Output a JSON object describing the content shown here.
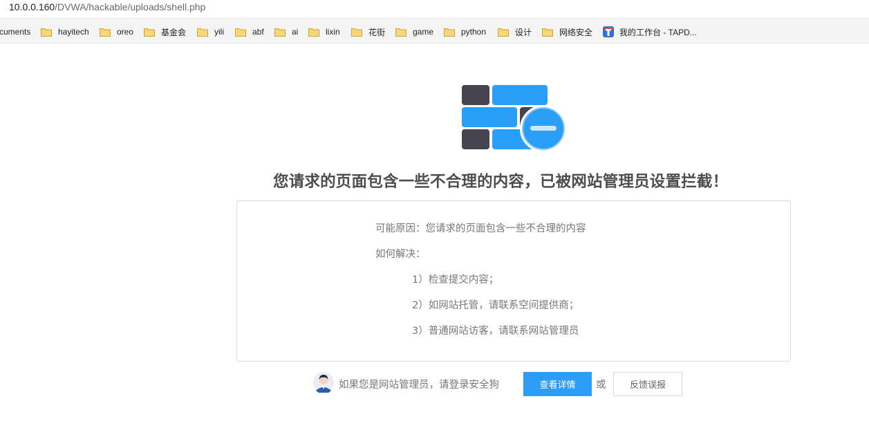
{
  "browser": {
    "url_host": "10.0.0.160",
    "url_path": "/DVWA/hackable/uploads/shell.php",
    "bookmarks": [
      {
        "label": "cuments",
        "icon": "folder-icon"
      },
      {
        "label": "hayitech",
        "icon": "folder-icon"
      },
      {
        "label": "oreo",
        "icon": "folder-icon"
      },
      {
        "label": "基金会",
        "icon": "folder-icon"
      },
      {
        "label": "yili",
        "icon": "folder-icon"
      },
      {
        "label": "abf",
        "icon": "folder-icon"
      },
      {
        "label": "ai",
        "icon": "folder-icon"
      },
      {
        "label": "lixin",
        "icon": "folder-icon"
      },
      {
        "label": "花街",
        "icon": "folder-icon"
      },
      {
        "label": "game",
        "icon": "folder-icon"
      },
      {
        "label": "python",
        "icon": "folder-icon"
      },
      {
        "label": "设计",
        "icon": "folder-icon"
      },
      {
        "label": "网络安全",
        "icon": "folder-icon"
      },
      {
        "label": "我的工作台 - TAPD...",
        "icon": "tapd-icon"
      }
    ]
  },
  "page": {
    "headline": "您请求的页面包含一些不合理的内容，已被网站管理员设置拦截！",
    "reason": "可能原因：您请求的页面包含一些不合理的内容",
    "how_to_solve": "如何解决：",
    "steps": [
      "1）检查提交内容；",
      "2）如网站托管，请联系空间提供商；",
      "3）普通网站访客，请联系网站管理员"
    ],
    "footer_text": "如果您是网站管理员，请登录安全狗",
    "detail_button": "查看详情",
    "or_text": "或",
    "report_button": "反馈误报"
  },
  "colors": {
    "accent_blue": "#2d9cf7",
    "brick_dark": "#46454f",
    "brick_blue": "#2b9ff8",
    "headline_gray": "#4d4d4d"
  }
}
